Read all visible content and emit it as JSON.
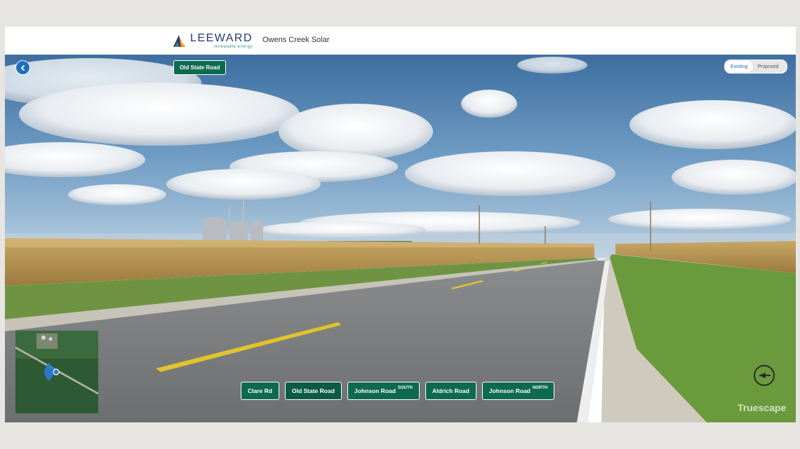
{
  "header": {
    "brand_name": "LEEWARD",
    "brand_tagline": "renewable energy",
    "project_title": "Owens Creek Solar"
  },
  "viewer": {
    "current_location": "Old State Road",
    "back_icon": "chevron-left-icon",
    "view_toggle": {
      "options": [
        "Existing",
        "Proposed"
      ],
      "selected": "Existing"
    },
    "watermark": "Truescape",
    "compass_icon": "compass-icon",
    "minimap_label": "minimap"
  },
  "locations": [
    {
      "label": "Clare Rd",
      "suffix": ""
    },
    {
      "label": "Old State Road",
      "suffix": ""
    },
    {
      "label": "Johnson Road",
      "suffix": "SOUTH"
    },
    {
      "label": "Aldrich Road",
      "suffix": ""
    },
    {
      "label": "Johnson Road",
      "suffix": "NORTH"
    }
  ],
  "colors": {
    "accent_green": "#0d6a4d",
    "accent_blue": "#1f6fc0",
    "brand_navy": "#1f3b70"
  }
}
